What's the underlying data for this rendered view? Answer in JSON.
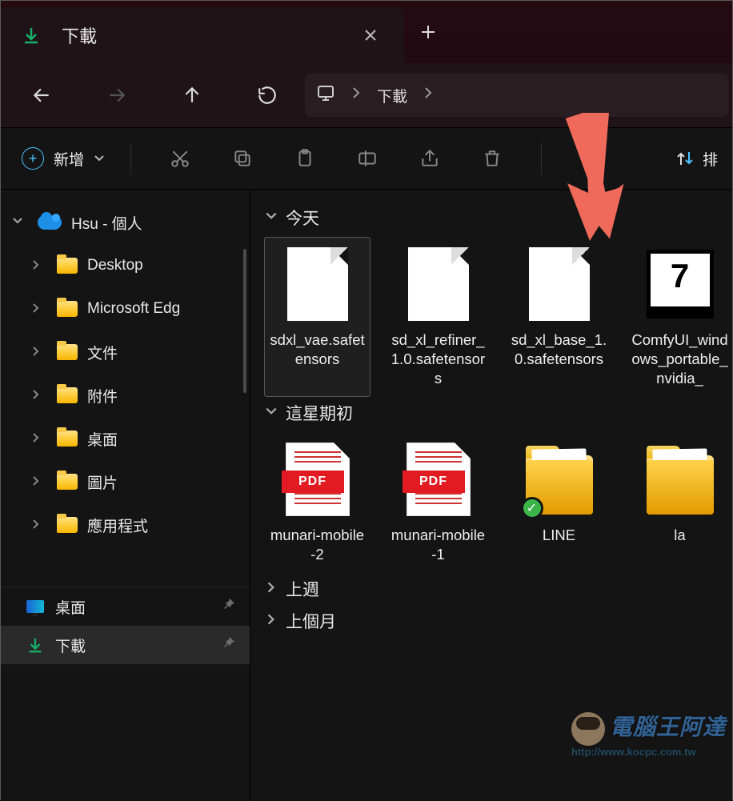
{
  "tab": {
    "title": "下載",
    "close_x": "✕"
  },
  "nav": {
    "breadcrumb_root_icon": "monitor",
    "breadcrumb_current": "下載"
  },
  "toolbar": {
    "new_label": "新增",
    "sort_label": "排"
  },
  "sidebar": {
    "root": {
      "label": "Hsu - 個人",
      "expanded": true
    },
    "items": [
      {
        "label": "Desktop"
      },
      {
        "label": "Microsoft Edg"
      },
      {
        "label": "文件"
      },
      {
        "label": "附件"
      },
      {
        "label": "桌面"
      },
      {
        "label": "圖片"
      },
      {
        "label": "應用程式"
      }
    ],
    "quick": [
      {
        "label": "桌面",
        "icon": "desktop"
      },
      {
        "label": "下載",
        "icon": "download"
      }
    ]
  },
  "groups": [
    {
      "title": "今天",
      "expanded": true,
      "files": [
        {
          "kind": "blank",
          "label": "sdxl_vae.safetensors",
          "selected": true
        },
        {
          "kind": "blank",
          "label": "sd_xl_refiner_1.0.safetensors"
        },
        {
          "kind": "blank",
          "label": "sd_xl_base_1.0.safetensors"
        },
        {
          "kind": "7z",
          "label": "ComfyUI_windows_portable_nvidia_"
        }
      ]
    },
    {
      "title": "這星期初",
      "expanded": true,
      "files": [
        {
          "kind": "pdf",
          "label": "munari-mobile-2"
        },
        {
          "kind": "pdf",
          "label": "munari-mobile-1"
        },
        {
          "kind": "folder-sync",
          "label": "LINE"
        },
        {
          "kind": "folder",
          "label": "la"
        }
      ]
    },
    {
      "title": "上週",
      "expanded": false,
      "files": []
    },
    {
      "title": "上個月",
      "expanded": false,
      "files": []
    }
  ],
  "icon_labels": {
    "pdf_band": "PDF",
    "sevenz_glyph": "7"
  },
  "watermark": {
    "text": "電腦王阿達",
    "url": "http://www.kocpc.com.tw"
  }
}
